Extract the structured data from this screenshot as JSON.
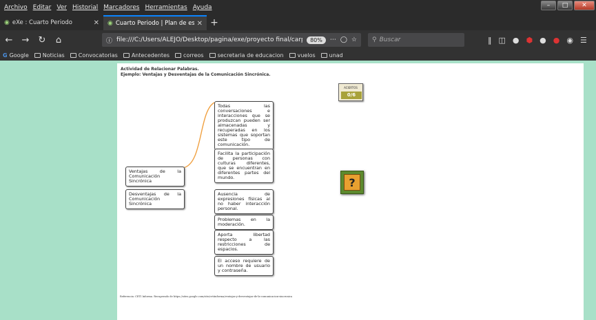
{
  "menubar": {
    "items": [
      "Archivo",
      "Editar",
      "Ver",
      "Historial",
      "Marcadores",
      "Herramientas",
      "Ayuda"
    ]
  },
  "tabs": [
    {
      "title": "eXe : Cuarto Periodo",
      "active": false,
      "icon": "exe-icon"
    },
    {
      "title": "Cuarto Periodo | Plan de estud",
      "active": true,
      "icon": "page-icon"
    }
  ],
  "navbar": {
    "url": "file:///C:/Users/ALEJO/Desktop/pagina/exe/proyecto final/carpe",
    "zoom": "80%",
    "search_placeholder": "Buscar"
  },
  "bookmarks": [
    {
      "label": "Google",
      "type": "google"
    },
    {
      "label": "Noticias",
      "type": "folder"
    },
    {
      "label": "Convocatorias",
      "type": "folder"
    },
    {
      "label": "Antecedentes",
      "type": "folder"
    },
    {
      "label": "correos",
      "type": "folder"
    },
    {
      "label": "secretaria de educacion",
      "type": "folder"
    },
    {
      "label": "vuelos",
      "type": "folder"
    },
    {
      "label": "unad",
      "type": "folder"
    }
  ],
  "activity": {
    "title_line1": "Actividad de Relacionar Palabras.",
    "title_line2": "Ejemplo: Ventajas y Desventajas de la Comunicación Sincrónica.",
    "left_cards": [
      "Ventajas de la Comunicación Sincrónica",
      "Desventajas de la Comunicación Sincrónica"
    ],
    "right_cards": [
      "Todas las conversaciones e interacciones que se produzcan pueden ser almacenadas y recuperadas en los sistemas que soportan este tipo de comunicación.",
      "Facilita la participación de personas con culturas diferentes, que se encuentran en diferentes partes del mundo.",
      "Ausencia de expresiones físicas al no haber interacción personal.",
      "Problemas en la moderación.",
      "Aporta libertad respecto a las restricciones de espacios.",
      "El acceso requiere de un nombre de usuario y contraseña."
    ],
    "score_label": "ACIERTOS",
    "score_value": "0/6",
    "help_symbol": "?",
    "reference": "Referencia: CETI Informa. Recuperado de https://sites.google.com/site/cetiinforma/ventajas-y-desventajas-de-la-comunicacion-sincronica"
  },
  "colors": {
    "connector": "#f0a040",
    "page_bg": "#a8e0c8"
  }
}
